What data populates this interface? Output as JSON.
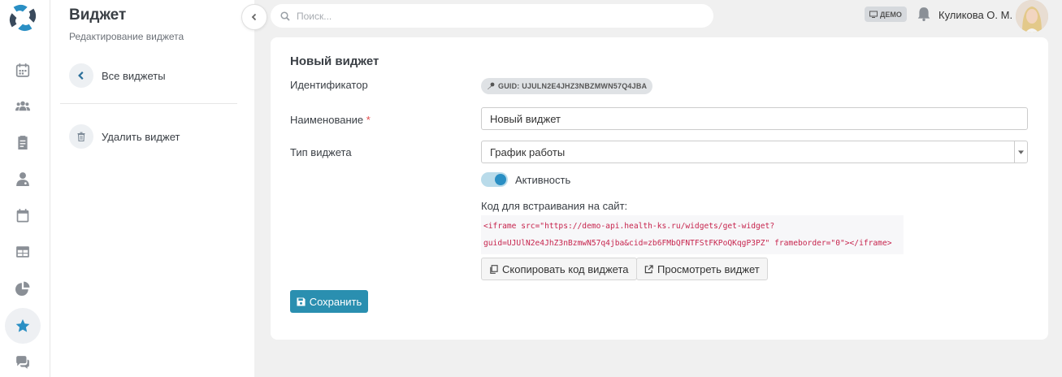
{
  "colors": {
    "accent": "#2a8fc4",
    "save_button": "#2a8fb0",
    "code_text": "#c7254e",
    "required": "#e14b4b"
  },
  "rail": {
    "items": [
      {
        "icon": "calendar-icon"
      },
      {
        "icon": "users-icon"
      },
      {
        "icon": "clipboard-icon"
      },
      {
        "icon": "doctor-icon"
      },
      {
        "icon": "calendar-day-icon"
      },
      {
        "icon": "table-icon"
      },
      {
        "icon": "pie-chart-icon"
      },
      {
        "icon": "star-icon",
        "active": true
      },
      {
        "icon": "chat-icon"
      }
    ]
  },
  "panel": {
    "title": "Виджет",
    "subtitle": "Редактирование виджета",
    "back_label": "Все виджеты",
    "delete_label": "Удалить виджет"
  },
  "search": {
    "placeholder": "Поиск..."
  },
  "header": {
    "demo_badge": "ДЕМО",
    "user_name": "Куликова О. М."
  },
  "form": {
    "title": "Новый виджет",
    "id_label": "Идентификатор",
    "guid": "GUID: UJULN2E4JHZ3NBZMWN57Q4JBA",
    "name_label": "Наименование",
    "name_required": "*",
    "name_value": "Новый виджет",
    "type_label": "Тип виджета",
    "type_value": "График работы",
    "active_label": "Активность",
    "active": true,
    "embed_label": "Код для встраивания на сайт:",
    "embed_line1": "<iframe src=\"https://demo-api.health-ks.ru/widgets/get-widget?",
    "embed_line2": "guid=UJUlN2e4JhZ3nBzmwN57q4jba&cid=zb6FMbQFNTFStFKPoQKqgP3PZ\" frameborder=\"0\"></iframe>",
    "copy_button": "Скопировать код виджета",
    "preview_button": "Просмотреть виджет",
    "save_button": "Сохранить"
  }
}
